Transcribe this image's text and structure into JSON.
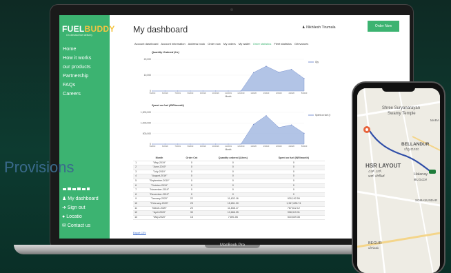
{
  "sidebar": {
    "brand_main": "FUEL",
    "brand_alt": "BUDDY",
    "tagline": "On demand fuel delivery",
    "items": [
      {
        "label": "Home"
      },
      {
        "label": "How it works"
      },
      {
        "label": "our products"
      },
      {
        "label": "Partnership"
      },
      {
        "label": "FAQs"
      },
      {
        "label": "Careers"
      }
    ],
    "overlay_text": "Provisions",
    "account_items": [
      {
        "label": "My dashboard"
      },
      {
        "label": "Sign out"
      },
      {
        "label": "Locatio"
      },
      {
        "label": "Contact us"
      }
    ]
  },
  "header": {
    "title": "My dashboard",
    "user_name": "Nikhilesh Tirumala",
    "order_button": "Order Now"
  },
  "tabs": [
    {
      "label": "Account dashboard",
      "active": false
    },
    {
      "label": "Account information",
      "active": false
    },
    {
      "label": "Address book",
      "active": false
    },
    {
      "label": "Order now",
      "active": false
    },
    {
      "label": "My orders",
      "active": false
    },
    {
      "label": "My wallet",
      "active": false
    },
    {
      "label": "Order statistics",
      "active": true
    },
    {
      "label": "Fleet statistics",
      "active": false
    },
    {
      "label": "Grievances",
      "active": false
    }
  ],
  "chart_data": [
    {
      "type": "area",
      "title": "Quantity Ordered (Ltr)",
      "xlabel": "Month",
      "ylabel": "",
      "series": [
        {
          "name": "Qty",
          "values": [
            0,
            0,
            0,
            0,
            0,
            0,
            0,
            0,
            11632,
            15651,
            11838,
            13666,
            7891
          ]
        }
      ],
      "categories": [
        "5/2019",
        "6/2019",
        "7/2019",
        "8/2019",
        "9/2019",
        "10/2019",
        "11/2019",
        "12/2019",
        "1/2020",
        "2/2020",
        "3/2020",
        "4/2020",
        "5/2020"
      ],
      "yticks": [
        "20,000",
        "10,000",
        "0"
      ],
      "ylim": [
        0,
        20000
      ],
      "color": "#9fb5e0",
      "legend": "top-right"
    },
    {
      "type": "area",
      "title": "Spent on fuel (INR/month)",
      "xlabel": "Month",
      "ylabel": "",
      "series": [
        {
          "name": "Spent on fuel (INR/month)",
          "values": [
            0,
            0,
            0,
            0,
            0,
            0,
            0,
            0,
            930192,
            1347628,
            787612,
            908319,
            510639
          ]
        }
      ],
      "categories": [
        "5/2019",
        "6/2019",
        "7/2019",
        "8/2019",
        "9/2019",
        "10/2019",
        "11/2019",
        "12/2019",
        "1/2020",
        "2/2020",
        "3/2020",
        "4/2020",
        "5/2020"
      ],
      "yticks": [
        "1,500,000",
        "1,000,000",
        "500,000",
        "0"
      ],
      "ylim": [
        0,
        1500000
      ],
      "color": "#9fb5e0",
      "legend": "top-right"
    }
  ],
  "table": {
    "headers": [
      "",
      "Month",
      "Order Cnt",
      "Quantity ordered (Liters)",
      "Spent on fuel (INR/month)"
    ],
    "rows": [
      [
        "1",
        "\"May-2019\"",
        "0",
        "0",
        "0"
      ],
      [
        "2",
        "\"June-2019\"",
        "0",
        "0",
        "0"
      ],
      [
        "3",
        "\"July-2019\"",
        "0",
        "0",
        "0"
      ],
      [
        "4",
        "\"August-2019\"",
        "0",
        "0",
        "0"
      ],
      [
        "5",
        "\"September-2019\"",
        "0",
        "0",
        "0"
      ],
      [
        "6",
        "\"October-2019\"",
        "0",
        "0",
        "0"
      ],
      [
        "7",
        "\"November-2019\"",
        "0",
        "0",
        "0"
      ],
      [
        "8",
        "\"December-2019\"",
        "0",
        "0",
        "0"
      ],
      [
        "9",
        "\"January-2020\"",
        "22",
        "11,632.16",
        "930,192.59"
      ],
      [
        "10",
        "\"February-2020\"",
        "23",
        "15,651.90",
        "1,347,628.74"
      ],
      [
        "11",
        "\"March-2020\"",
        "20",
        "11,838.17",
        "787,612.12"
      ],
      [
        "12",
        "\"April-2020\"",
        "30",
        "13,666.05",
        "908,319.31"
      ],
      [
        "13",
        "\"May-2020\"",
        "16",
        "7,891.06",
        "510,639.35"
      ]
    ]
  },
  "export_label": "Export CSV",
  "laptop_model": "MacBook Pro",
  "phone_map": {
    "labels": [
      "Shree Suryanarayan",
      "Swamy Temple",
      "BELLANDUR",
      "ಬೆಳ್ಳಂದೂರು",
      "HSR LAYOUT",
      "ಎಚ್.ಎಸ್.",
      "ಆರ್ ಲೇಔಟ್",
      "Halanay",
      "ಹಲನಾಯಕ",
      "BEGUR",
      "ಬೇಗೂರು",
      "MARA",
      "SOMASUNDAR"
    ]
  }
}
